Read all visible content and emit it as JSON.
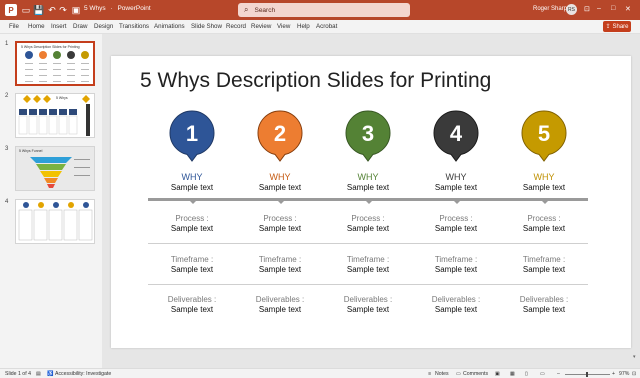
{
  "titlebar": {
    "doc_name": "5 Whys",
    "app_name": "PowerPoint",
    "doc_title": "5 Whys  ·  PowerPoint",
    "search_placeholder": "Search",
    "user_name": "Roger Sharp",
    "user_initials": "RS",
    "app_letter": "P"
  },
  "ribbon": {
    "tabs": [
      "File",
      "Home",
      "Insert",
      "Draw",
      "Design",
      "Transitions",
      "Animations",
      "Slide Show",
      "Record",
      "Review",
      "View",
      "Help",
      "Acrobat"
    ],
    "share_label": "Share"
  },
  "thumbnails": [
    {
      "number": "1",
      "selected": true,
      "caption": "5 Whys Description Slides for Printing"
    },
    {
      "number": "2",
      "selected": false,
      "caption": "5 Whys"
    },
    {
      "number": "3",
      "selected": false,
      "caption": "5 Whys Funnel"
    },
    {
      "number": "4",
      "selected": false,
      "caption": ""
    }
  ],
  "slide": {
    "title": "5 Whys Description Slides for Printing",
    "columns": [
      {
        "number": "1",
        "color": "#2e5597",
        "why_label": "WHY",
        "why_color": "#2e5597",
        "sample": "Sample text",
        "process_label": "Process :",
        "process_text": "Sample text",
        "timeframe_label": "Timeframe :",
        "timeframe_text": "Sample text",
        "deliverables_label": "Deliverables :",
        "deliverables_text": "Sample text"
      },
      {
        "number": "2",
        "color": "#ed7d31",
        "why_label": "WHY",
        "why_color": "#c55a11",
        "sample": "Sample text",
        "process_label": "Process :",
        "process_text": "Sample text",
        "timeframe_label": "Timeframe :",
        "timeframe_text": "Sample text",
        "deliverables_label": "Deliverables :",
        "deliverables_text": "Sample text"
      },
      {
        "number": "3",
        "color": "#548235",
        "why_label": "WHY",
        "why_color": "#548235",
        "sample": "Sample text",
        "process_label": "Process :",
        "process_text": "Sample text",
        "timeframe_label": "Timeframe :",
        "timeframe_text": "Sample text",
        "deliverables_label": "Deliverables :",
        "deliverables_text": "Sample text"
      },
      {
        "number": "4",
        "color": "#3a3a3a",
        "why_label": "WHY",
        "why_color": "#3a3a3a",
        "sample": "Sample text",
        "process_label": "Process :",
        "process_text": "Sample text",
        "timeframe_label": "Timeframe :",
        "timeframe_text": "Sample text",
        "deliverables_label": "Deliverables :",
        "deliverables_text": "Sample text"
      },
      {
        "number": "5",
        "color": "#c59a00",
        "why_label": "WHY",
        "why_color": "#bf9000",
        "sample": "Sample text",
        "process_label": "Process :",
        "process_text": "Sample text",
        "timeframe_label": "Timeframe :",
        "timeframe_text": "Sample text",
        "deliverables_label": "Deliverables :",
        "deliverables_text": "Sample text"
      }
    ]
  },
  "statusbar": {
    "slide_info": "Slide 1 of 4",
    "accessibility": "Accessibility: Investigate",
    "notes": "Notes",
    "comments": "Comments",
    "zoom": "97%"
  }
}
